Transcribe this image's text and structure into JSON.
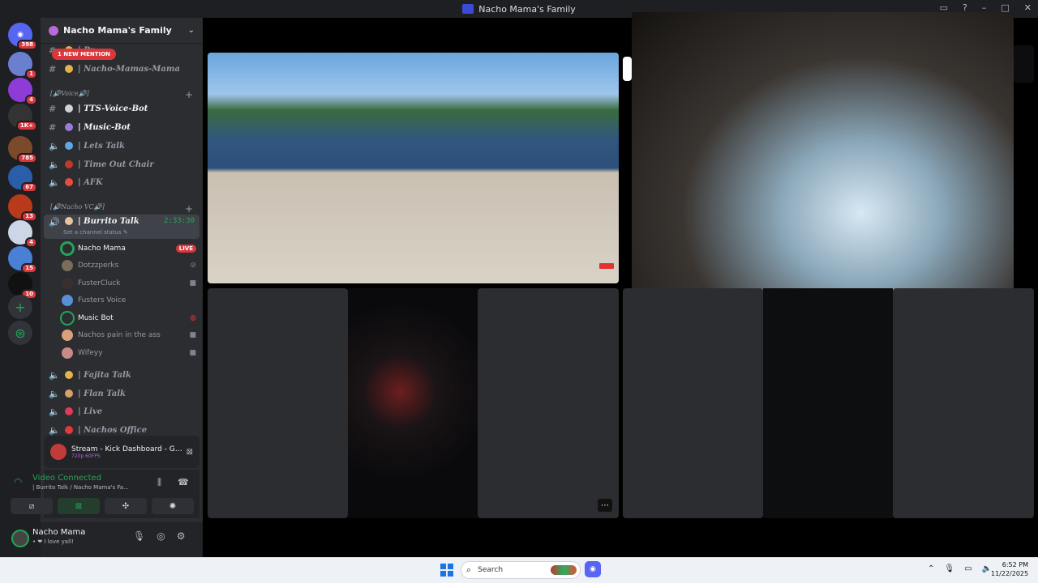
{
  "window": {
    "title": "Nacho Mama's Family"
  },
  "servers": {
    "badges": [
      "398",
      "1",
      "4",
      "1K+",
      "785",
      "67",
      "13",
      "4",
      "15",
      "10"
    ]
  },
  "guild": {
    "name": "Nacho Mama's Family"
  },
  "mention_banner": "1 NEW MENTION",
  "channels_top": [
    {
      "label": "| Pr",
      "icon": "hash-icon"
    },
    {
      "label": "| Nacho-Mamas-Mama",
      "icon": "hash-icon"
    }
  ],
  "category_voice": "[🔊Voice🔊]",
  "voice_text_channels": [
    {
      "label": "| TTS-Voice-Bot",
      "icon": "hash-icon"
    },
    {
      "label": "| Music-Bot",
      "icon": "hash-icon"
    },
    {
      "label": "| Lets Talk",
      "icon": "speaker-icon"
    },
    {
      "label": "| Time Out Chair",
      "icon": "speaker-icon"
    },
    {
      "label": "| AFK",
      "icon": "speaker-icon"
    }
  ],
  "category_nacho_vc": "[🔊Nacho VC🔊]",
  "active_channel": {
    "label": "| Burrito Talk",
    "timer": "2:33:30",
    "status": "Set a channel status"
  },
  "voice_users": [
    {
      "name": "Nacho Mama",
      "live": "LIVE"
    },
    {
      "name": "Dotzzperks"
    },
    {
      "name": "FusterCluck"
    },
    {
      "name": "Fusters Voice"
    },
    {
      "name": "Music Bot"
    },
    {
      "name": "Nachos pain in the ass"
    },
    {
      "name": "Wifeyy"
    }
  ],
  "more_channels": [
    {
      "label": "| Fajita Talk"
    },
    {
      "label": "| Flan Talk"
    },
    {
      "label": "| Live"
    },
    {
      "label": "| Nachos Office"
    }
  ],
  "stream_panel": {
    "title": "Stream - Kick Dashboard - Google ...",
    "quality": "720p 60FPS"
  },
  "voice_panel": {
    "status": "Video Connected",
    "location": "| Burrito Talk / Nacho Mama's Fa..."
  },
  "user_panel": {
    "name": "Nacho Mama",
    "status": "• ❤ I love yall!"
  },
  "taskbar": {
    "search_placeholder": "Search",
    "time": "6:52 PM",
    "date": "11/22/2025"
  },
  "colors": {
    "accent": "#5865f2",
    "online": "#23a559",
    "danger": "#da373c",
    "sidebar": "#2b2d31",
    "rail": "#1e1f22"
  }
}
